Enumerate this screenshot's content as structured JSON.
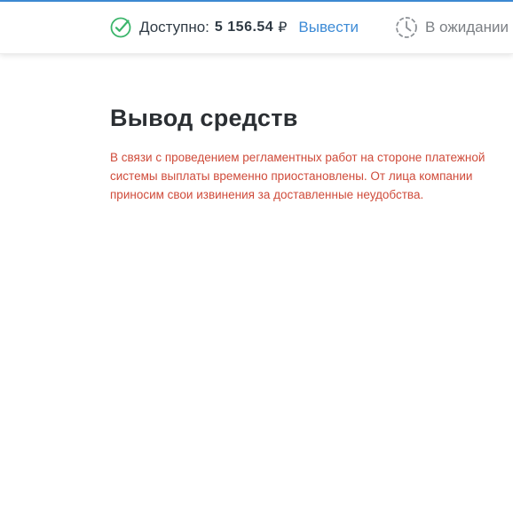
{
  "header": {
    "available_label": "Доступно:",
    "available_amount": "5 156.54",
    "currency_symbol": "₽",
    "withdraw_link": "Вывести",
    "pending_label": "В ожидании"
  },
  "main": {
    "title": "Вывод средств",
    "notice": "В связи с проведением регламентных работ на стороне платежной системы выплаты временно приостановлены. От лица компании приносим свои извинения за доставленные неудобства."
  },
  "colors": {
    "accent": "#3d8bd6",
    "success_icon": "#3bb56b",
    "pending_icon": "#8d9196",
    "notice_text": "#cf4b3a"
  },
  "icons": {
    "available": "check-circle-icon",
    "pending": "clock-icon"
  }
}
